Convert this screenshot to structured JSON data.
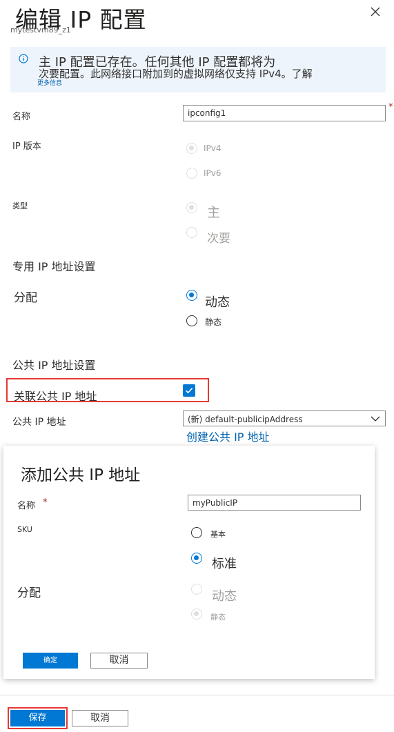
{
  "header": {
    "title": "编辑 IP 配置",
    "subtitle": "mytestvm89_z1",
    "close_icon": "close-icon"
  },
  "info": {
    "icon": "info-icon",
    "line1": "主 IP 配置已存在。任何其他 IP 配置都将为",
    "line2": "次要配置。此网络接口附加到的虚拟网络仅支持 IPv4。了解",
    "link": "更多信息",
    "background": "#eef4fb"
  },
  "form": {
    "name_label": "名称",
    "name_value": "ipconfig1",
    "required_mark": "*",
    "ip_version_label": "IP 版本",
    "ip_version_options": [
      "IPv4",
      "IPv6"
    ],
    "ip_version_selected": "IPv4",
    "type_label": "类型",
    "type_options": [
      "主",
      "次要"
    ],
    "type_selected": "主"
  },
  "private_ip": {
    "section_title": "专用 IP 地址设置",
    "assignment_label": "分配",
    "options": [
      "动态",
      "静态"
    ],
    "selected": "动态"
  },
  "public_ip": {
    "section_title": "公共 IP 地址设置",
    "associate_label": "关联公共 IP 地址",
    "associate_checked": true,
    "address_label": "公共 IP 地址",
    "address_value": "(新) default-publicipAddress",
    "create_link": "创建公共 IP 地址"
  },
  "add_public_ip_panel": {
    "title": "添加公共 IP 地址",
    "name_label": "名称",
    "required_mark": "*",
    "name_value": "myPublicIP",
    "sku_label": "SKU",
    "sku_options": [
      "基本",
      "标准"
    ],
    "sku_selected": "标准",
    "assignment_label": "分配",
    "assignment_options": [
      "动态",
      "静态"
    ],
    "assignment_selected": "静态",
    "ok_button": "确定",
    "cancel_button": "取消"
  },
  "footer": {
    "save_button": "保存",
    "cancel_button": "取消"
  },
  "colors": {
    "accent": "#0078d4",
    "highlight_border": "#e53935",
    "link": "#0063b1"
  }
}
